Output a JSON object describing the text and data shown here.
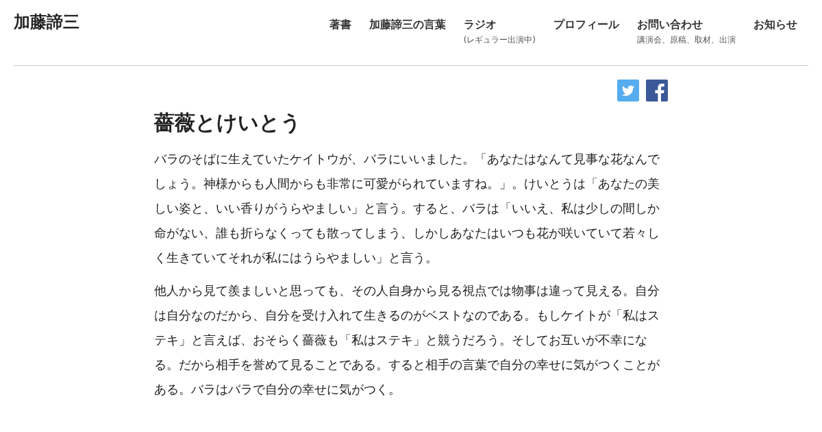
{
  "site_title": "加藤諦三",
  "nav": [
    {
      "label": "著書"
    },
    {
      "label": "加藤諦三の言葉"
    },
    {
      "label": "ラジオ",
      "sub": "(レギュラー出演中)"
    },
    {
      "label": "プロフィール"
    },
    {
      "label": "お問い合わせ",
      "sub": "講演会、原稿、取材、出演"
    },
    {
      "label": "お知らせ"
    }
  ],
  "share": [
    {
      "kind": "twitter"
    },
    {
      "kind": "facebook"
    }
  ],
  "article": {
    "title": "薔薇とけいとう",
    "paragraphs": [
      "バラのそばに生えていたケイトウが、バラにいいました。「あなたはなんて見事な花なんでしょう。神様からも人間からも非常に可愛がられていますね。」。けいとうは「あなたの美しい姿と、いい香りがうらやましい」と言う。すると、バラは「いいえ、私は少しの間しか命がない、誰も折らなくっても散ってしまう、しかしあなたはいつも花が咲いていて若々しく生きていてそれが私にはうらやましい」と言う。",
      "他人から見て羨ましいと思っても、その人自身から見る視点では物事は違って見える。自分は自分なのだから、自分を受け入れて生きるのがベストなのである。もしケイトが「私はステキ」と言えば、おそらく薔薇も「私はステキ」と競うだろう。そしてお互いが不幸になる。だから相手を誉めて見ることである。すると相手の言葉で自分の幸せに気がつくことがある。バラはバラで自分の幸せに気がつく。"
    ]
  }
}
